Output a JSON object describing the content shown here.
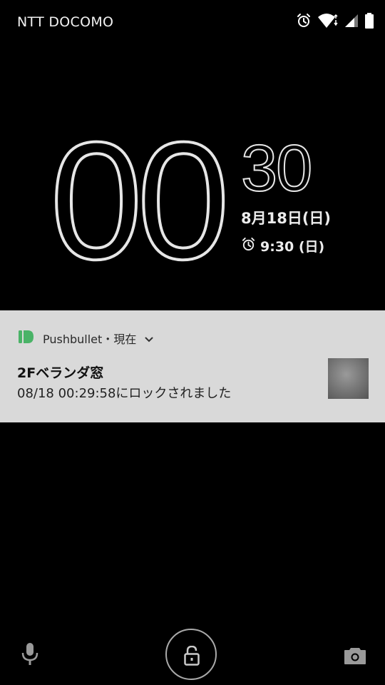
{
  "status_bar": {
    "carrier": "NTT DOCOMO",
    "icons": [
      "alarm-icon",
      "wifi-icon",
      "signal-icon",
      "battery-icon"
    ]
  },
  "clock": {
    "hours": "00",
    "minutes": "30",
    "date": "8月18日(日)",
    "next_alarm": "9:30 (日)"
  },
  "notification": {
    "app_icon": "pushbullet-icon",
    "app_name": "Pushbullet",
    "separator": "・",
    "time": "現在",
    "title": "2Fベランダ窓",
    "body": "08/18 00:29:58にロックされました",
    "thumbnail": "image-thumbnail",
    "colors": {
      "background": "#d9d9d9",
      "app_icon": "#4ab367"
    }
  },
  "bottom_bar": {
    "left": "mic-icon",
    "center": "unlock-icon",
    "right": "camera-icon"
  }
}
